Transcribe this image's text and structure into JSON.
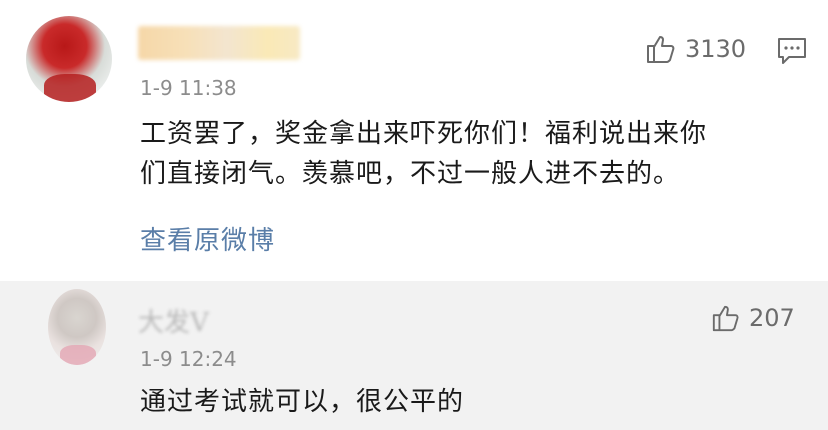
{
  "comment": {
    "time": "1-9 11:38",
    "like_count": "3130",
    "text_line1": "工资罢了，奖金拿出来吓死你们！福利说出来你",
    "text_line2": "们直接闭气。羡慕吧，不过一般人进不去的。",
    "view_original": "查看原微博"
  },
  "reply": {
    "username_blurred": "大发V",
    "time": "1-9 12:24",
    "like_count": "207",
    "text": "通过考试就可以，很公平的"
  },
  "icons": {
    "like": "thumbs-up-icon",
    "reply": "comment-bubble-icon"
  }
}
